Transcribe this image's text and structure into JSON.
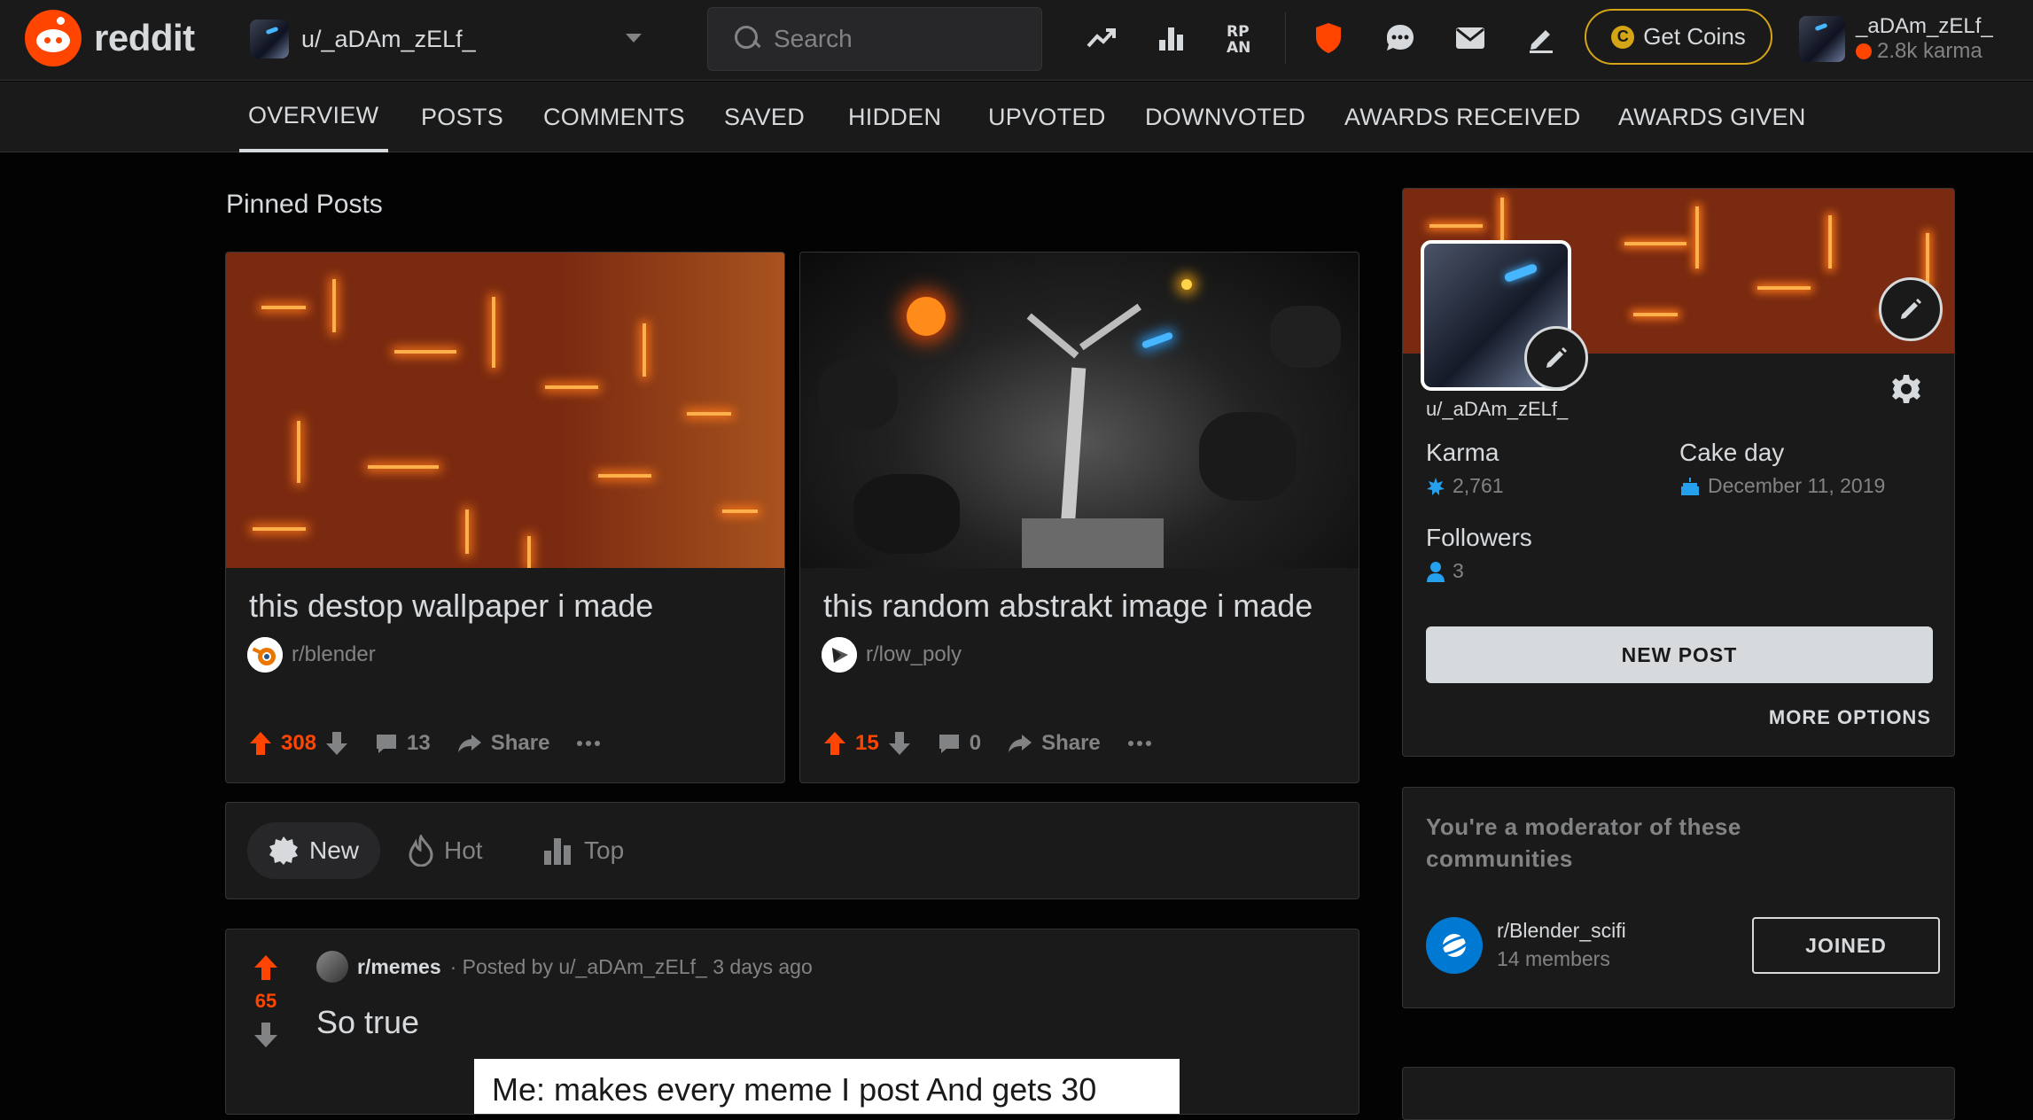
{
  "header": {
    "logo_text": "reddit",
    "user_dropdown": "u/_aDAm_zELf_",
    "search_placeholder": "Search",
    "get_coins": "Get Coins",
    "coin_symbol": "C",
    "account_name": "_aDAm_zELf_",
    "account_karma": "2.8k karma",
    "icons": [
      "popular-icon",
      "all-icon",
      "rpan-icon",
      "mod-shield-icon",
      "chat-icon",
      "mail-icon",
      "create-post-icon"
    ]
  },
  "tabs": [
    {
      "label": "OVERVIEW",
      "active": true
    },
    {
      "label": "POSTS"
    },
    {
      "label": "COMMENTS"
    },
    {
      "label": "SAVED"
    },
    {
      "label": "HIDDEN"
    },
    {
      "label": "UPVOTED"
    },
    {
      "label": "DOWNVOTED"
    },
    {
      "label": "AWARDS RECEIVED"
    },
    {
      "label": "AWARDS GIVEN"
    }
  ],
  "pinned": {
    "title": "Pinned Posts",
    "posts": [
      {
        "title": "this destop wallpaper i made",
        "subreddit": "r/blender",
        "votes": "308",
        "comments": "13",
        "share": "Share"
      },
      {
        "title": "this random abstrakt image i made",
        "subreddit": "r/low_poly",
        "votes": "15",
        "comments": "0",
        "share": "Share"
      }
    ]
  },
  "sort": {
    "new": "New",
    "hot": "Hot",
    "top": "Top",
    "active": "New"
  },
  "post": {
    "subreddit": "r/memes",
    "meta": "· Posted by u/_aDAm_zELf_ 3 days ago",
    "votes": "65",
    "title": "So true",
    "image_text": "Me: makes every meme I post And gets 30"
  },
  "profile": {
    "username": "u/_aDAm_zELf_",
    "karma_label": "Karma",
    "karma_value": "2,761",
    "cakeday_label": "Cake day",
    "cakeday_value": "December 11, 2019",
    "followers_label": "Followers",
    "followers_value": "3",
    "new_post": "NEW POST",
    "more_options": "MORE OPTIONS"
  },
  "moderator": {
    "title": "You're a moderator of these communities",
    "community": "r/Blender_scifi",
    "members": "14 members",
    "joined": "JOINED"
  },
  "colors": {
    "accent": "#ff4500",
    "background": "#030303",
    "card": "#1a1a1b",
    "border": "#343536",
    "text": "#d7dadc",
    "muted": "#818384",
    "coin": "#d4a514",
    "blue": "#0079d3"
  }
}
